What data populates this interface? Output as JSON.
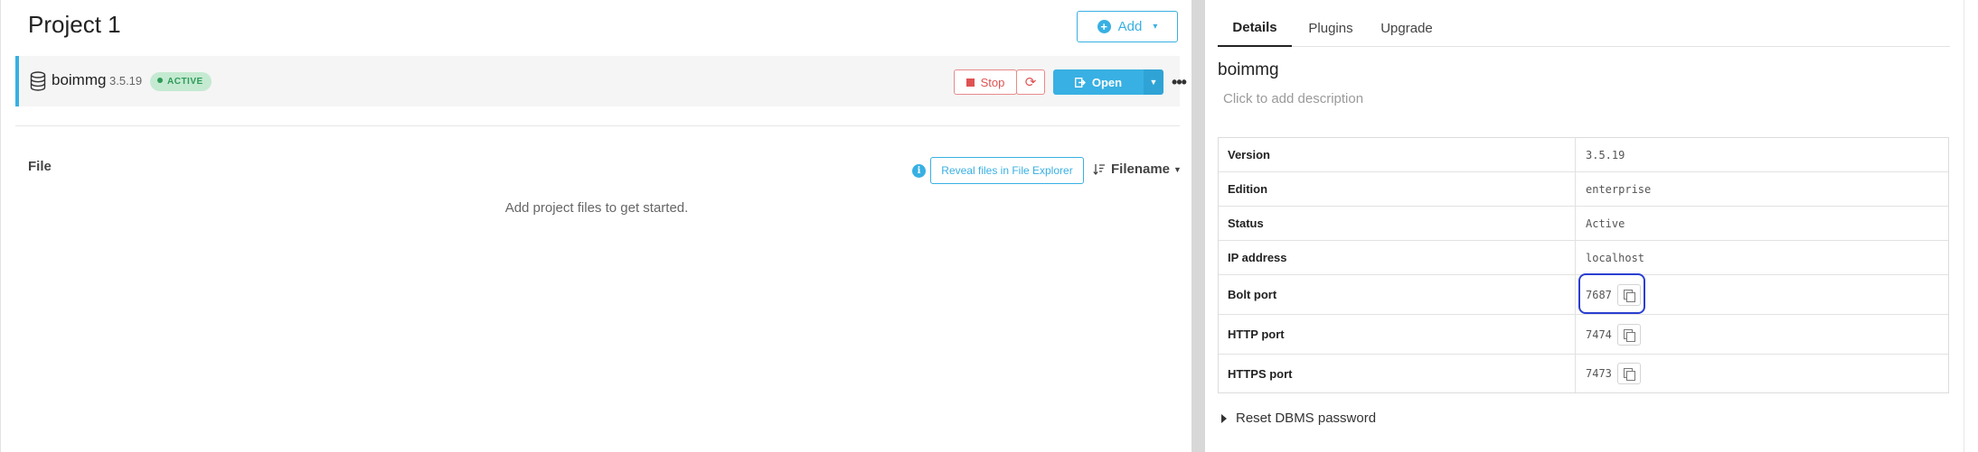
{
  "project": {
    "title": "Project 1",
    "add_label": "Add"
  },
  "dbms": {
    "name": "boimmg",
    "version": "3.5.19",
    "status_badge": "ACTIVE",
    "stop_label": "Stop",
    "open_label": "Open",
    "more_label": "•••"
  },
  "files": {
    "heading": "File",
    "reveal_label": "Reveal files in File Explorer",
    "sort_label": "Filename",
    "empty_message": "Add project files to get started."
  },
  "tabs": [
    {
      "label": "Details",
      "active": true
    },
    {
      "label": "Plugins",
      "active": false
    },
    {
      "label": "Upgrade",
      "active": false
    }
  ],
  "details": {
    "name": "boimmg",
    "description_placeholder": "Click to add description",
    "rows": [
      {
        "key": "Version",
        "value": "3.5.19",
        "copyable": false
      },
      {
        "key": "Edition",
        "value": "enterprise",
        "copyable": false
      },
      {
        "key": "Status",
        "value": "Active",
        "copyable": false
      },
      {
        "key": "IP address",
        "value": "localhost",
        "copyable": false
      },
      {
        "key": "Bolt port",
        "value": "7687",
        "copyable": true
      },
      {
        "key": "HTTP port",
        "value": "7474",
        "copyable": true
      },
      {
        "key": "HTTPS port",
        "value": "7473",
        "copyable": true
      }
    ],
    "reset_password_label": "Reset DBMS password"
  },
  "colors": {
    "accent": "#38b0e3",
    "stop_red": "#e05252",
    "active_green": "#2e9b58",
    "annotation_blue": "#2a3fd1"
  }
}
